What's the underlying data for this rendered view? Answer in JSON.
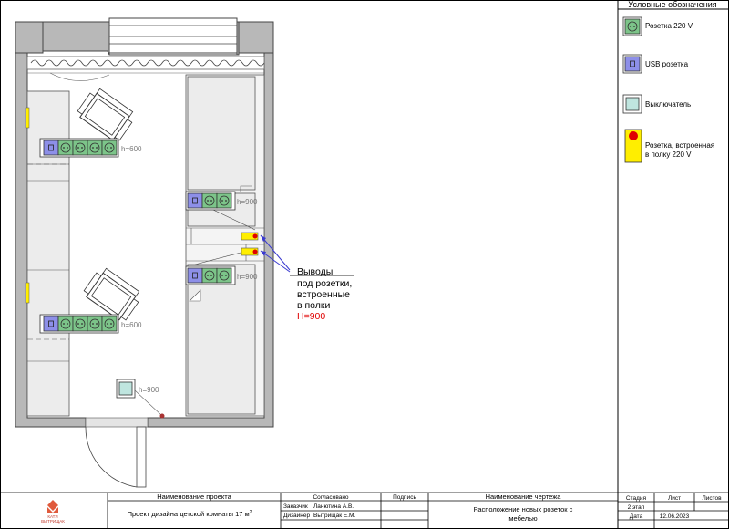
{
  "legend": {
    "title": "Условные обозначения",
    "items": [
      {
        "id": "socket",
        "label": "Розетка 220 V"
      },
      {
        "id": "usb",
        "label": "USB розетка"
      },
      {
        "id": "switch",
        "label": "Выключатель"
      },
      {
        "id": "shelf",
        "label_line1": "Розетка, встроенная",
        "label_line2": "в полку 220 V"
      }
    ]
  },
  "plan": {
    "heights": {
      "desk_top": "h=600",
      "desk_bottom": "h=600",
      "wardrobe_top": "h=900",
      "wardrobe_mid": "h=900",
      "switch": "h=900"
    },
    "callout": {
      "line1": "Выводы",
      "line2": "под розетки,",
      "line3": "встроенные",
      "line4": "в полки",
      "height": "H=900"
    }
  },
  "title_block": {
    "logo_line1": "КАТЯ",
    "logo_line2": "ВЫТРИЩАК",
    "project_header": "Наименование проекта",
    "project_name": "Проект дизайна детской комнаты 17 м",
    "project_sup": "2",
    "agreed_header": "Согласовано",
    "signature_header": "Подпись",
    "customer_role": "Заказчик",
    "customer_name": "Ланютина А.В.",
    "designer_role": "Дизайнер",
    "designer_name": "Вытрищак Е.М.",
    "drawing_header": "Наименование чертежа",
    "drawing_line1": "Расположение новых розеток с",
    "drawing_line2": "мебелью",
    "stage_header": "Стадия",
    "stage_value": "2 этап",
    "sheet_header": "Лист",
    "sheets_header": "Листов",
    "date_header": "Дата",
    "date_value": "12.06.2023"
  },
  "colors": {
    "socket_fill": "#7cc489",
    "usb_fill": "#8d8fe8",
    "switch_fill": "#bfe5df",
    "shelf_fill": "#ffee00",
    "shelf_dot": "#e00000",
    "wall": "#b8b8b8",
    "furniture": "#ececec",
    "callout_accent": "#e00000",
    "leader": "#3a3ad0"
  }
}
